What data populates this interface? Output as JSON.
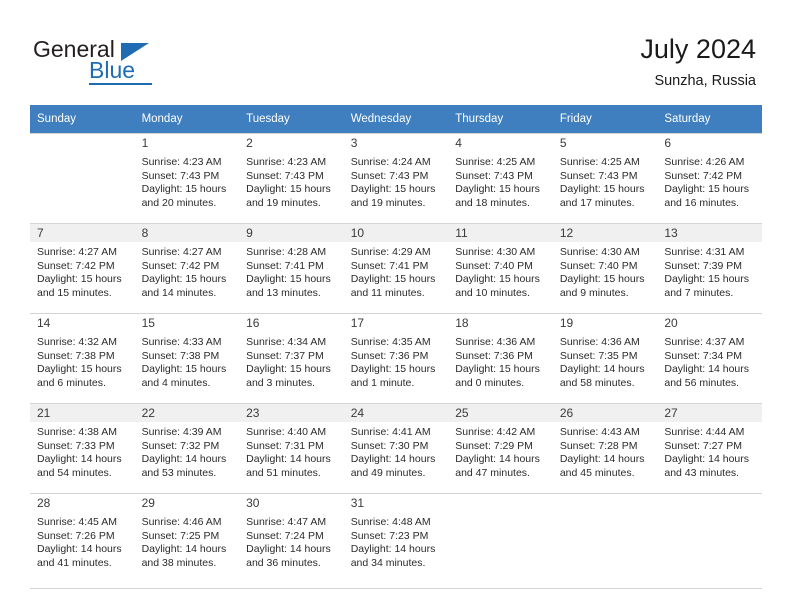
{
  "brand": {
    "name_part1": "General",
    "name_part2": "Blue",
    "accent_color": "#1f6cb4"
  },
  "header": {
    "title": "July 2024",
    "subtitle": "Sunzha, Russia",
    "header_bg": "#3f7fbf",
    "shaded_row_bg": "#f0f0f0"
  },
  "weekdays": [
    "Sunday",
    "Monday",
    "Tuesday",
    "Wednesday",
    "Thursday",
    "Friday",
    "Saturday"
  ],
  "weeks": [
    {
      "shaded": false,
      "days": [
        {
          "num": "",
          "sunrise": "",
          "sunset": "",
          "daylight": ""
        },
        {
          "num": "1",
          "sunrise": "Sunrise: 4:23 AM",
          "sunset": "Sunset: 7:43 PM",
          "daylight": "Daylight: 15 hours and 20 minutes."
        },
        {
          "num": "2",
          "sunrise": "Sunrise: 4:23 AM",
          "sunset": "Sunset: 7:43 PM",
          "daylight": "Daylight: 15 hours and 19 minutes."
        },
        {
          "num": "3",
          "sunrise": "Sunrise: 4:24 AM",
          "sunset": "Sunset: 7:43 PM",
          "daylight": "Daylight: 15 hours and 19 minutes."
        },
        {
          "num": "4",
          "sunrise": "Sunrise: 4:25 AM",
          "sunset": "Sunset: 7:43 PM",
          "daylight": "Daylight: 15 hours and 18 minutes."
        },
        {
          "num": "5",
          "sunrise": "Sunrise: 4:25 AM",
          "sunset": "Sunset: 7:43 PM",
          "daylight": "Daylight: 15 hours and 17 minutes."
        },
        {
          "num": "6",
          "sunrise": "Sunrise: 4:26 AM",
          "sunset": "Sunset: 7:42 PM",
          "daylight": "Daylight: 15 hours and 16 minutes."
        }
      ]
    },
    {
      "shaded": true,
      "days": [
        {
          "num": "7",
          "sunrise": "Sunrise: 4:27 AM",
          "sunset": "Sunset: 7:42 PM",
          "daylight": "Daylight: 15 hours and 15 minutes."
        },
        {
          "num": "8",
          "sunrise": "Sunrise: 4:27 AM",
          "sunset": "Sunset: 7:42 PM",
          "daylight": "Daylight: 15 hours and 14 minutes."
        },
        {
          "num": "9",
          "sunrise": "Sunrise: 4:28 AM",
          "sunset": "Sunset: 7:41 PM",
          "daylight": "Daylight: 15 hours and 13 minutes."
        },
        {
          "num": "10",
          "sunrise": "Sunrise: 4:29 AM",
          "sunset": "Sunset: 7:41 PM",
          "daylight": "Daylight: 15 hours and 11 minutes."
        },
        {
          "num": "11",
          "sunrise": "Sunrise: 4:30 AM",
          "sunset": "Sunset: 7:40 PM",
          "daylight": "Daylight: 15 hours and 10 minutes."
        },
        {
          "num": "12",
          "sunrise": "Sunrise: 4:30 AM",
          "sunset": "Sunset: 7:40 PM",
          "daylight": "Daylight: 15 hours and 9 minutes."
        },
        {
          "num": "13",
          "sunrise": "Sunrise: 4:31 AM",
          "sunset": "Sunset: 7:39 PM",
          "daylight": "Daylight: 15 hours and 7 minutes."
        }
      ]
    },
    {
      "shaded": false,
      "days": [
        {
          "num": "14",
          "sunrise": "Sunrise: 4:32 AM",
          "sunset": "Sunset: 7:38 PM",
          "daylight": "Daylight: 15 hours and 6 minutes."
        },
        {
          "num": "15",
          "sunrise": "Sunrise: 4:33 AM",
          "sunset": "Sunset: 7:38 PM",
          "daylight": "Daylight: 15 hours and 4 minutes."
        },
        {
          "num": "16",
          "sunrise": "Sunrise: 4:34 AM",
          "sunset": "Sunset: 7:37 PM",
          "daylight": "Daylight: 15 hours and 3 minutes."
        },
        {
          "num": "17",
          "sunrise": "Sunrise: 4:35 AM",
          "sunset": "Sunset: 7:36 PM",
          "daylight": "Daylight: 15 hours and 1 minute."
        },
        {
          "num": "18",
          "sunrise": "Sunrise: 4:36 AM",
          "sunset": "Sunset: 7:36 PM",
          "daylight": "Daylight: 15 hours and 0 minutes."
        },
        {
          "num": "19",
          "sunrise": "Sunrise: 4:36 AM",
          "sunset": "Sunset: 7:35 PM",
          "daylight": "Daylight: 14 hours and 58 minutes."
        },
        {
          "num": "20",
          "sunrise": "Sunrise: 4:37 AM",
          "sunset": "Sunset: 7:34 PM",
          "daylight": "Daylight: 14 hours and 56 minutes."
        }
      ]
    },
    {
      "shaded": true,
      "days": [
        {
          "num": "21",
          "sunrise": "Sunrise: 4:38 AM",
          "sunset": "Sunset: 7:33 PM",
          "daylight": "Daylight: 14 hours and 54 minutes."
        },
        {
          "num": "22",
          "sunrise": "Sunrise: 4:39 AM",
          "sunset": "Sunset: 7:32 PM",
          "daylight": "Daylight: 14 hours and 53 minutes."
        },
        {
          "num": "23",
          "sunrise": "Sunrise: 4:40 AM",
          "sunset": "Sunset: 7:31 PM",
          "daylight": "Daylight: 14 hours and 51 minutes."
        },
        {
          "num": "24",
          "sunrise": "Sunrise: 4:41 AM",
          "sunset": "Sunset: 7:30 PM",
          "daylight": "Daylight: 14 hours and 49 minutes."
        },
        {
          "num": "25",
          "sunrise": "Sunrise: 4:42 AM",
          "sunset": "Sunset: 7:29 PM",
          "daylight": "Daylight: 14 hours and 47 minutes."
        },
        {
          "num": "26",
          "sunrise": "Sunrise: 4:43 AM",
          "sunset": "Sunset: 7:28 PM",
          "daylight": "Daylight: 14 hours and 45 minutes."
        },
        {
          "num": "27",
          "sunrise": "Sunrise: 4:44 AM",
          "sunset": "Sunset: 7:27 PM",
          "daylight": "Daylight: 14 hours and 43 minutes."
        }
      ]
    },
    {
      "shaded": false,
      "days": [
        {
          "num": "28",
          "sunrise": "Sunrise: 4:45 AM",
          "sunset": "Sunset: 7:26 PM",
          "daylight": "Daylight: 14 hours and 41 minutes."
        },
        {
          "num": "29",
          "sunrise": "Sunrise: 4:46 AM",
          "sunset": "Sunset: 7:25 PM",
          "daylight": "Daylight: 14 hours and 38 minutes."
        },
        {
          "num": "30",
          "sunrise": "Sunrise: 4:47 AM",
          "sunset": "Sunset: 7:24 PM",
          "daylight": "Daylight: 14 hours and 36 minutes."
        },
        {
          "num": "31",
          "sunrise": "Sunrise: 4:48 AM",
          "sunset": "Sunset: 7:23 PM",
          "daylight": "Daylight: 14 hours and 34 minutes."
        },
        {
          "num": "",
          "sunrise": "",
          "sunset": "",
          "daylight": ""
        },
        {
          "num": "",
          "sunrise": "",
          "sunset": "",
          "daylight": ""
        },
        {
          "num": "",
          "sunrise": "",
          "sunset": "",
          "daylight": ""
        }
      ]
    }
  ]
}
